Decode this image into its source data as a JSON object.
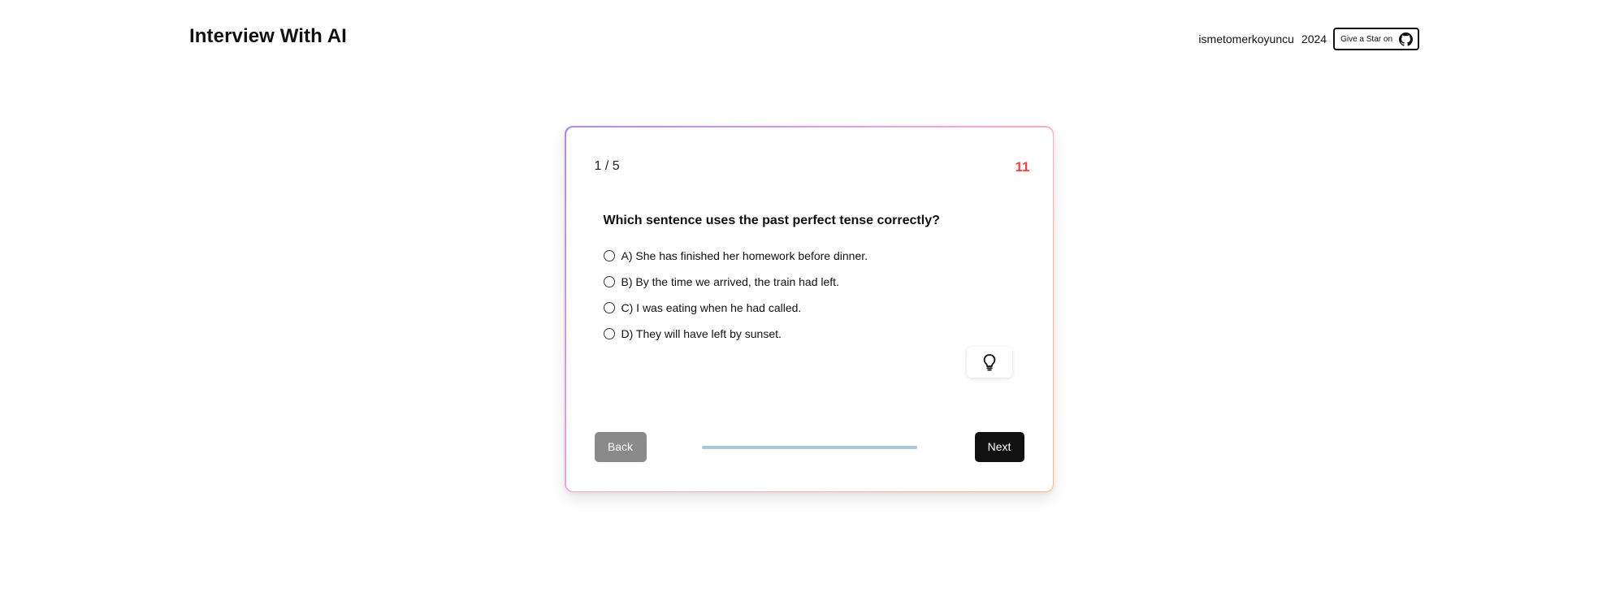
{
  "header": {
    "title": "Interview With AI",
    "author": "ismetomerkoyuncu",
    "year": "2024",
    "star_button_label": "Give a Star on",
    "star_button_icon": "github-icon"
  },
  "quiz": {
    "progress_label": "1 / 5",
    "timer": "11",
    "timer_color": "#ef4444",
    "question": "Which sentence uses the past perfect tense correctly?",
    "options": [
      {
        "label": "A) She has finished her homework before dinner.",
        "selected": false
      },
      {
        "label": "B) By the time we arrived, the train had left.",
        "selected": false
      },
      {
        "label": "C) I was eating when he had called.",
        "selected": false
      },
      {
        "label": "D) They will have left by sunset.",
        "selected": false
      }
    ],
    "hint_icon": "lightbulb-icon",
    "back_label": "Back",
    "next_label": "Next",
    "progress_fraction": 1.0
  }
}
